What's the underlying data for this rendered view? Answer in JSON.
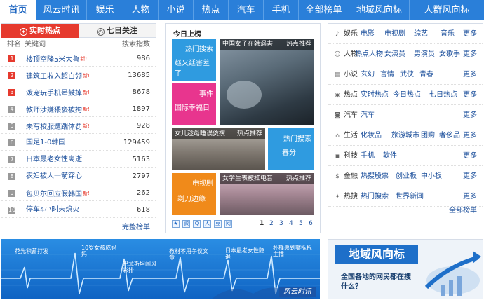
{
  "nav": [
    "首页",
    "风云时讯",
    "娱乐",
    "人物",
    "小说",
    "热点",
    "汽车",
    "手机",
    "全部榜单",
    "地域风向标",
    "人群风向标"
  ],
  "left": {
    "tab_hot": "实时热点",
    "tab_week": "七日关注",
    "head": {
      "rank": "排名",
      "keyword": "关键词",
      "count": "搜索指数"
    },
    "rows": [
      {
        "rank": "1",
        "kw": "楼顶空降5米大鲁",
        "new": true,
        "count": "986"
      },
      {
        "rank": "2",
        "kw": "建筑工收入超白领",
        "new": true,
        "count": "13685"
      },
      {
        "rank": "3",
        "kw": "泼宠玩手机晕鼓掉",
        "new": true,
        "count": "8678"
      },
      {
        "rank": "4",
        "kw": "教师涉嫌猥亵被拘",
        "new": true,
        "count": "1897"
      },
      {
        "rank": "5",
        "kw": "未写校服遭踹体罚",
        "new": true,
        "count": "928"
      },
      {
        "rank": "6",
        "kw": "国足1-0韩国",
        "new": false,
        "count": "129459"
      },
      {
        "rank": "7",
        "kw": "日本最老女性离逝",
        "new": false,
        "count": "5163"
      },
      {
        "rank": "8",
        "kw": "农妇被人一箭穿心",
        "new": false,
        "count": "2797"
      },
      {
        "rank": "9",
        "kw": "包贝尔回应假韩国",
        "new": true,
        "count": "262"
      },
      {
        "rank": "10",
        "kw": "停车4小时未熄火",
        "new": false,
        "count": "618"
      }
    ],
    "more": "完整榜单"
  },
  "mid": {
    "title": "今日上榜",
    "t1_tag": "热门搜索",
    "t1_text": "赵又廷害羞了",
    "photo1_left": "中国女子在韩遇害",
    "photo1_right": "热点推荐",
    "t2_tag": "事件",
    "t2_text": "国际幸福日",
    "photo2_left": "女儿趁母睡误烫搜",
    "photo2_right": "热点推荐",
    "t3_tag": "热门搜索",
    "t3_text": "春分",
    "t4_tag": "电视剧",
    "t4_text": "剃刀边缘",
    "photo3_left": "女学生表被扛电音",
    "photo3_right": "热点推荐",
    "shares": [
      "★",
      "微",
      "Q",
      "人",
      "豆",
      "网"
    ],
    "pages": [
      "1",
      "2",
      "3",
      "4",
      "5",
      "6"
    ]
  },
  "right": {
    "cats": [
      {
        "icon": "♪",
        "name": "娱乐",
        "links": [
          "电影",
          "电视剧",
          "综艺",
          "音乐"
        ]
      },
      {
        "icon": "☺",
        "name": "人物",
        "links": [
          "热点人物",
          "女演员",
          "男演员",
          "女歌手"
        ]
      },
      {
        "icon": "▤",
        "name": "小说",
        "links": [
          "玄幻",
          "言情",
          "武侠",
          "青春"
        ]
      },
      {
        "icon": "◉",
        "name": "热点",
        "links": [
          "实时热点",
          "今日热点",
          "七日热点"
        ]
      },
      {
        "icon": "◙",
        "name": "汽车",
        "links": [
          "汽车"
        ]
      },
      {
        "icon": "⌂",
        "name": "生活",
        "links": [
          "化妆品",
          "旅游城市",
          "团购",
          "奢侈品"
        ]
      },
      {
        "icon": "▣",
        "name": "科技",
        "links": [
          "手机",
          "软件"
        ]
      },
      {
        "icon": "$",
        "name": "金融",
        "links": [
          "热搜股票",
          "创业板",
          "中小板"
        ]
      },
      {
        "icon": "✦",
        "name": "热搜",
        "links": [
          "热门搜索",
          "世界新闻"
        ]
      }
    ],
    "more": "更多",
    "all": "全部榜单"
  },
  "wave": {
    "labels": [
      "花光积蓄打发",
      "10岁女孩成妈妈",
      "巴菲斯坦闻风彩排",
      "教材不用争议文章",
      "日本最老女性隐退",
      "朴槿惠到案拆拆主播"
    ],
    "brand": "风云时讯"
  },
  "region": {
    "title": "地域风向标",
    "sub": "全国各地的网民都在搜什么？"
  }
}
